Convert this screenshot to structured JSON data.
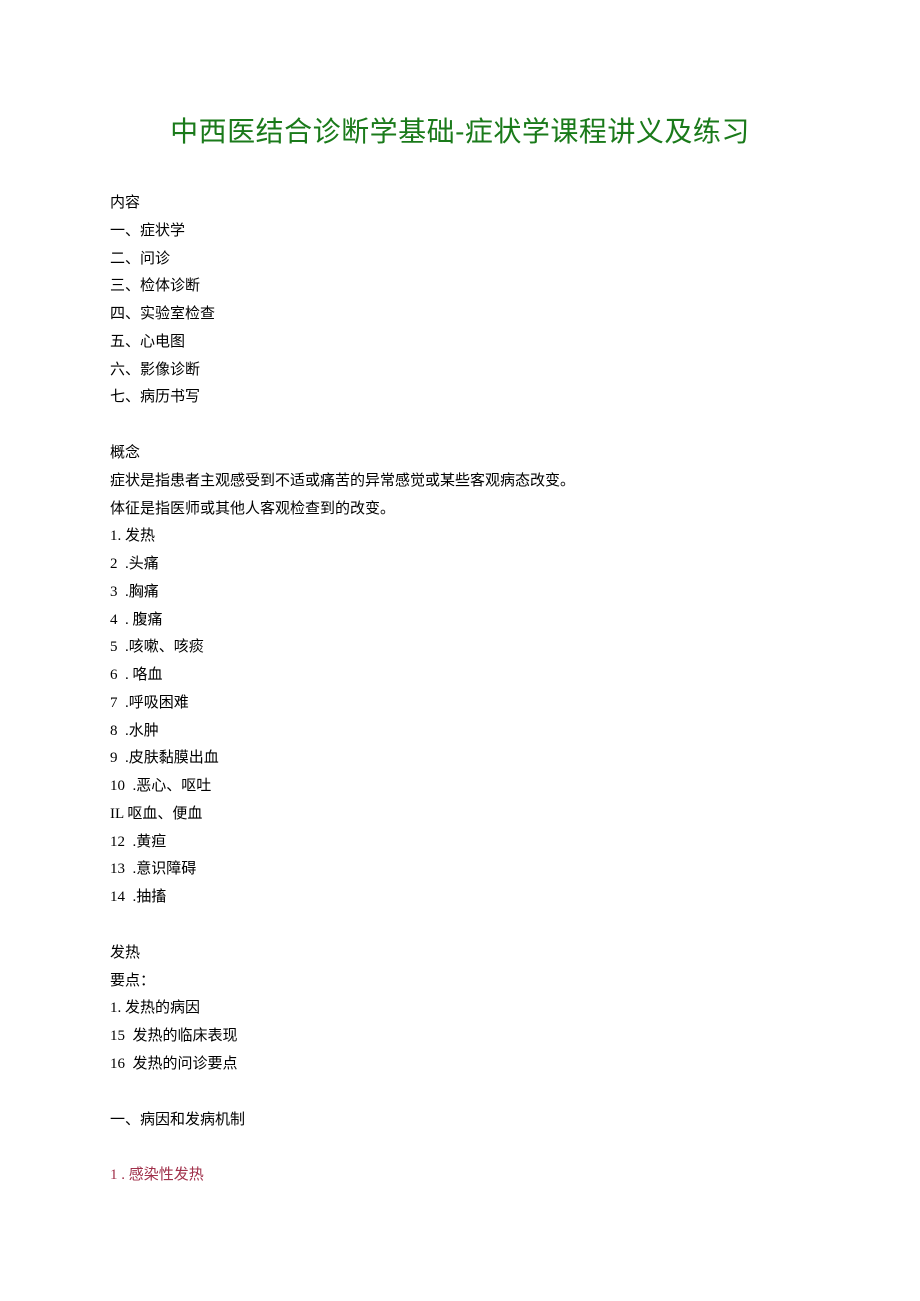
{
  "title": "中西医结合诊断学基础-症状学课程讲义及练习",
  "section_contents": {
    "heading": "内容",
    "items": [
      "一、症状学",
      "二、问诊",
      "三、检体诊断",
      "四、实验室检查",
      "五、心电图",
      "六、影像诊断",
      "七、病历书写"
    ]
  },
  "section_concept": {
    "heading": "概念",
    "lines": [
      "症状是指患者主观感受到不适或痛苦的异常感觉或某些客观病态改变。",
      "体征是指医师或其他人客观检查到的改变。",
      "1. 发热",
      "2  .头痛",
      "3  .胸痛",
      "4  . 腹痛",
      "5  .咳嗽、咳痰",
      "6  . 咯血",
      "7  .呼吸困难",
      "8  .水肿",
      "9  .皮肤黏膜出血",
      "10  .恶心、呕吐",
      "IL 呕血、便血",
      "12  .黄疸",
      "13  .意识障碍",
      "14  .抽搐"
    ]
  },
  "section_fever": {
    "heading": "发热",
    "lines": [
      "要点：",
      "1. 发热的病因",
      "15  发热的临床表现",
      "16  发热的问诊要点"
    ]
  },
  "section_etiology": {
    "heading": "一、病因和发病机制"
  },
  "section_infectious": {
    "heading": "1 . 感染性发热"
  }
}
